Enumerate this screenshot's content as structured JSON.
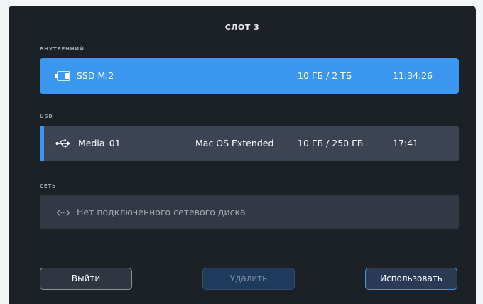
{
  "slot": {
    "title": "СЛОТ 3"
  },
  "sections": {
    "internal_label": "ВНУТРЕННИЙ",
    "usb_label": "USB",
    "network_label": "СЕТЬ"
  },
  "internal_drive": {
    "name": "SSD M.2",
    "usage": "10 ГБ / 2 ТБ",
    "time": "11:34:26",
    "icon": "ssd-icon"
  },
  "usb_drive": {
    "name": "Media_01",
    "format": "Mac OS Extended",
    "usage": "10 ГБ / 250 ГБ",
    "time": "17:41",
    "icon": "usb-icon"
  },
  "network_drive": {
    "message": "Нет подключенного сетевого диска",
    "icon": "network-icon"
  },
  "buttons": {
    "exit": "Выйти",
    "delete": "Удалить",
    "use": "Использовать"
  },
  "colors": {
    "accent": "#3b97f0",
    "background": "#1c2027",
    "row": "#3c4352"
  }
}
